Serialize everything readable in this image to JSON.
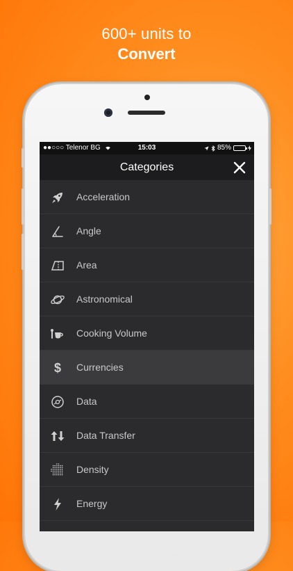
{
  "headline": {
    "line1": "600+ units to",
    "line2": "Convert"
  },
  "statusbar": {
    "carrier": "●●○○○ Telenor BG",
    "time": "15:03",
    "battery": "85%",
    "battery_level": 0.85
  },
  "navbar": {
    "title": "Categories"
  },
  "categories": [
    {
      "label": "Acceleration",
      "icon": "rocket-icon"
    },
    {
      "label": "Angle",
      "icon": "angle-icon"
    },
    {
      "label": "Area",
      "icon": "area-icon"
    },
    {
      "label": "Astronomical",
      "icon": "planet-icon"
    },
    {
      "label": "Cooking Volume",
      "icon": "cup-icon"
    },
    {
      "label": "Currencies",
      "icon": "dollar-icon",
      "selected": true
    },
    {
      "label": "Data",
      "icon": "disc-icon"
    },
    {
      "label": "Data Transfer",
      "icon": "arrows-up-down-icon"
    },
    {
      "label": "Density",
      "icon": "dots-sphere-icon"
    },
    {
      "label": "Energy",
      "icon": "lightning-icon"
    }
  ],
  "colors": {
    "background": "#ff8d1f",
    "accent": "#4cd964"
  }
}
